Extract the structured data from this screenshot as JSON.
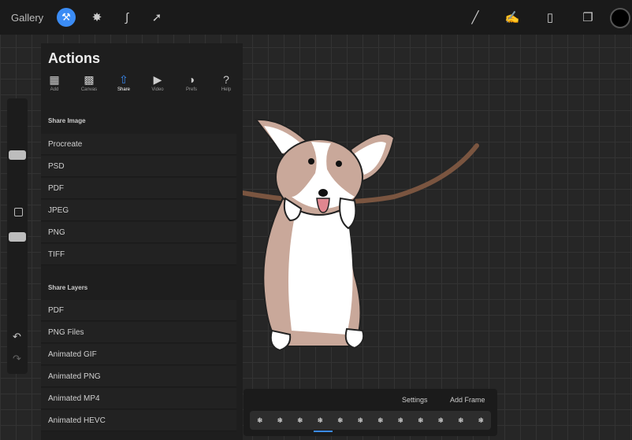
{
  "topbar": {
    "gallery_label": "Gallery",
    "tools_left": [
      "wrench-icon",
      "magic-wand-icon",
      "selection-icon",
      "transform-icon"
    ],
    "tools_right": [
      "brush-icon",
      "smudge-icon",
      "eraser-icon",
      "layers-icon"
    ],
    "current_color": "#000000"
  },
  "actions": {
    "title": "Actions",
    "tabs": [
      {
        "label": "Add",
        "icon": "add-icon"
      },
      {
        "label": "Canvas",
        "icon": "canvas-icon"
      },
      {
        "label": "Share",
        "icon": "share-icon",
        "active": true
      },
      {
        "label": "Video",
        "icon": "video-icon"
      },
      {
        "label": "Prefs",
        "icon": "prefs-icon"
      },
      {
        "label": "Help",
        "icon": "help-icon"
      }
    ],
    "share_image_header": "Share Image",
    "share_image_items": [
      "Procreate",
      "PSD",
      "PDF",
      "JPEG",
      "PNG",
      "TIFF"
    ],
    "share_layers_header": "Share Layers",
    "share_layers_items": [
      "PDF",
      "PNG Files",
      "Animated GIF",
      "Animated PNG",
      "Animated MP4",
      "Animated HEVC"
    ]
  },
  "timeline": {
    "settings_label": "Settings",
    "add_frame_label": "Add Frame",
    "frame_count": 12,
    "active_frame": 4
  },
  "accent_color": "#3b8cf5"
}
